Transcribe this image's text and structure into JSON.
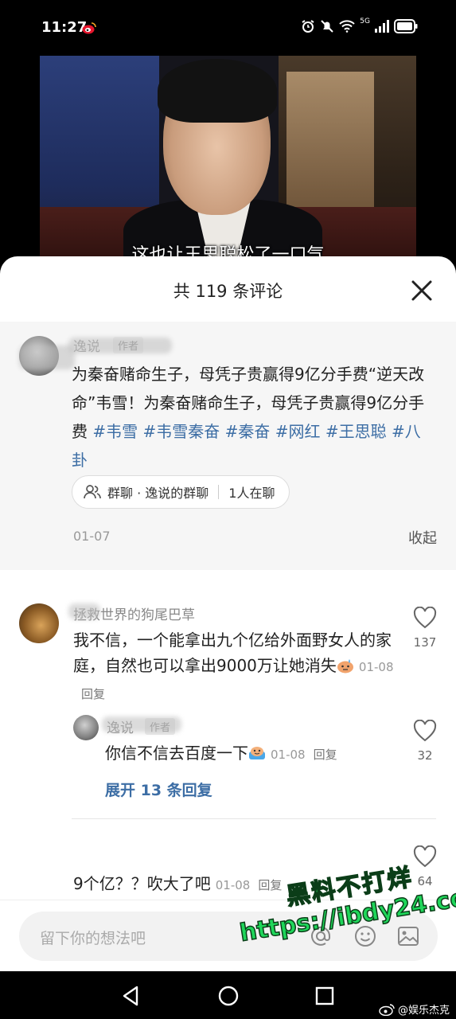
{
  "status_bar": {
    "time": "11:27",
    "network": "5G"
  },
  "video": {
    "subtitle": "这也让王思聪松了一口气"
  },
  "sheet": {
    "title": "共 119 条评论"
  },
  "pinned": {
    "author": "逸说",
    "tag": "作者",
    "text_plain": "为秦奋赌命生子，母凭子贵赢得9亿分手费“逆天改命”韦雪！为秦奋赌命生子，母凭子贵赢得9亿分手费 ",
    "hashtags": [
      "#韦雪",
      "#韦雪秦奋",
      "#秦奋",
      "#网红",
      "#王思聪",
      "#八卦"
    ],
    "group_chip": {
      "label": "群聊 · 逸说的群聊",
      "count": "1人在聊"
    },
    "date": "01-07",
    "collapse": "收起"
  },
  "comments": [
    {
      "author": "拯救世界的狗尾巴草",
      "text": "我不信，一个能拿出九个亿给外面野女人的家庭，自然也可以拿出9000万让她消失",
      "date": "01-08",
      "reply": "回复",
      "likes": "137"
    },
    {
      "author": "逸说",
      "tag": "作者",
      "text": "你信不信去百度一下",
      "date": "01-08",
      "reply": "回复",
      "likes": "32"
    },
    {
      "text": "9个亿？？吹大了吧",
      "date": "01-08",
      "reply": "回复",
      "likes": "64"
    }
  ],
  "expand_replies": "展开 13 条回复",
  "input": {
    "placeholder": "留下你的想法吧"
  },
  "watermark": {
    "line1": "黑料不打烊",
    "line2": "https://ibdy24.com"
  },
  "credit": "@娱乐杰克",
  "colors": {
    "link": "#3d6ea5",
    "watermark": "#1fd65a"
  }
}
